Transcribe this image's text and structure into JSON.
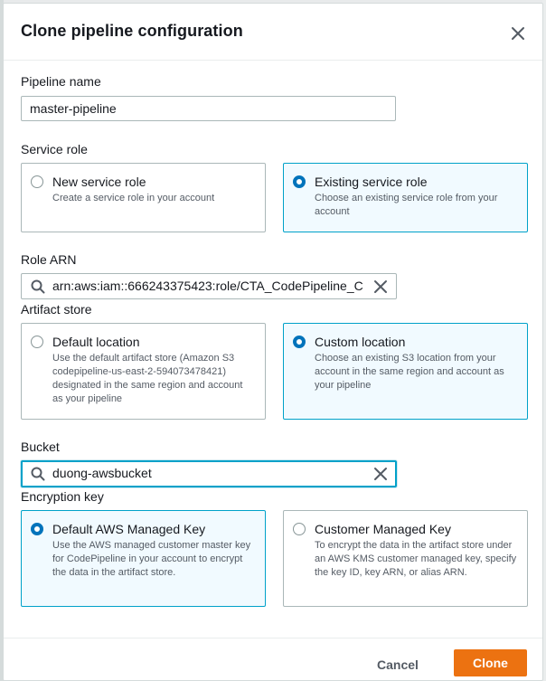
{
  "modal": {
    "title": "Clone pipeline configuration"
  },
  "pipeline_name": {
    "label": "Pipeline name",
    "value": "master-pipeline"
  },
  "service_role": {
    "label": "Service role",
    "options": [
      {
        "title": "New service role",
        "description": "Create a service role in your account",
        "selected": false
      },
      {
        "title": "Existing service role",
        "description": "Choose an existing service role from your account",
        "selected": true
      }
    ]
  },
  "role_arn": {
    "label": "Role ARN",
    "value": "arn:aws:iam::666243375423:role/CTA_CodePipeline_C"
  },
  "artifact_store": {
    "label": "Artifact store",
    "options": [
      {
        "title": "Default location",
        "description": "Use the default artifact store (Amazon S3 codepipeline-us-east-2-594073478421) designated in the same region and account as your pipeline",
        "selected": false
      },
      {
        "title": "Custom location",
        "description": "Choose an existing S3 location from your account in the same region and account as your pipeline",
        "selected": true
      }
    ]
  },
  "bucket": {
    "label": "Bucket",
    "value": "duong-awsbucket"
  },
  "encryption_key": {
    "label": "Encryption key",
    "options": [
      {
        "title": "Default AWS Managed Key",
        "description": "Use the AWS managed customer master key for CodePipeline in your account to encrypt the data in the artifact store.",
        "selected": true
      },
      {
        "title": "Customer Managed Key",
        "description": "To encrypt the data in the artifact store under an AWS KMS customer managed key, specify the key ID, key ARN, or alias ARN.",
        "selected": false
      }
    ]
  },
  "footer": {
    "cancel_label": "Cancel",
    "clone_label": "Clone"
  },
  "colors": {
    "primary_button": "#ec7211",
    "selected_border": "#00a1c9",
    "selected_background": "#f1faff",
    "radio_selected": "#0073bb"
  },
  "icons": {
    "close": "close-icon",
    "search": "search-icon",
    "clear": "clear-icon"
  }
}
